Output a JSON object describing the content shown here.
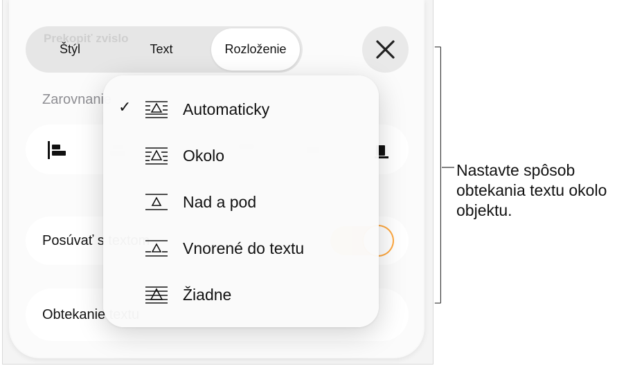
{
  "tabs": {
    "ghost_title": "Prekopiť zvislo",
    "style": "Štýl",
    "text": "Text",
    "layout": "Rozloženie"
  },
  "section": {
    "header": "Zarovnanie"
  },
  "rows": {
    "move_label": "Posúvať s textom",
    "wrap_label": "Obtekanie textu"
  },
  "menu": {
    "items": [
      {
        "label": "Automaticky",
        "checked": true,
        "icon": "wrap-automatic-icon"
      },
      {
        "label": "Okolo",
        "checked": false,
        "icon": "wrap-around-icon"
      },
      {
        "label": "Nad a pod",
        "checked": false,
        "icon": "wrap-above-below-icon"
      },
      {
        "label": "Vnorené do textu",
        "checked": false,
        "icon": "wrap-inline-icon"
      },
      {
        "label": "Žiadne",
        "checked": false,
        "icon": "wrap-none-icon"
      }
    ],
    "check_glyph": "✓"
  },
  "callout": {
    "text": "Nastavte spôsob obtekania textu okolo objektu."
  },
  "colors": {
    "accent": "#ff9a1e",
    "panel": "#fbfbfb"
  }
}
